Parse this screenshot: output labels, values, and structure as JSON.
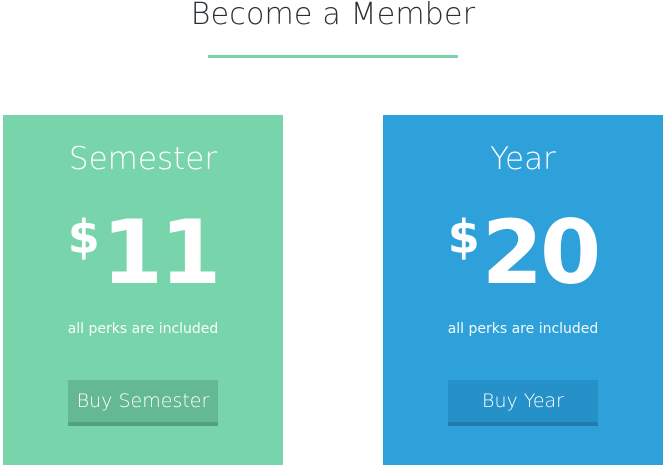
{
  "header": {
    "title": "Become a Member"
  },
  "colors": {
    "accent_green": "#78d4ab",
    "accent_blue": "#2ea1db",
    "title_text": "#2a2f33"
  },
  "plans": [
    {
      "name": "Semester",
      "currency": "$",
      "price": "11",
      "note": "all perks are included",
      "button_label": "Buy Semester"
    },
    {
      "name": "Year",
      "currency": "$",
      "price": "20",
      "note": "all perks are included",
      "button_label": "Buy Year"
    }
  ]
}
